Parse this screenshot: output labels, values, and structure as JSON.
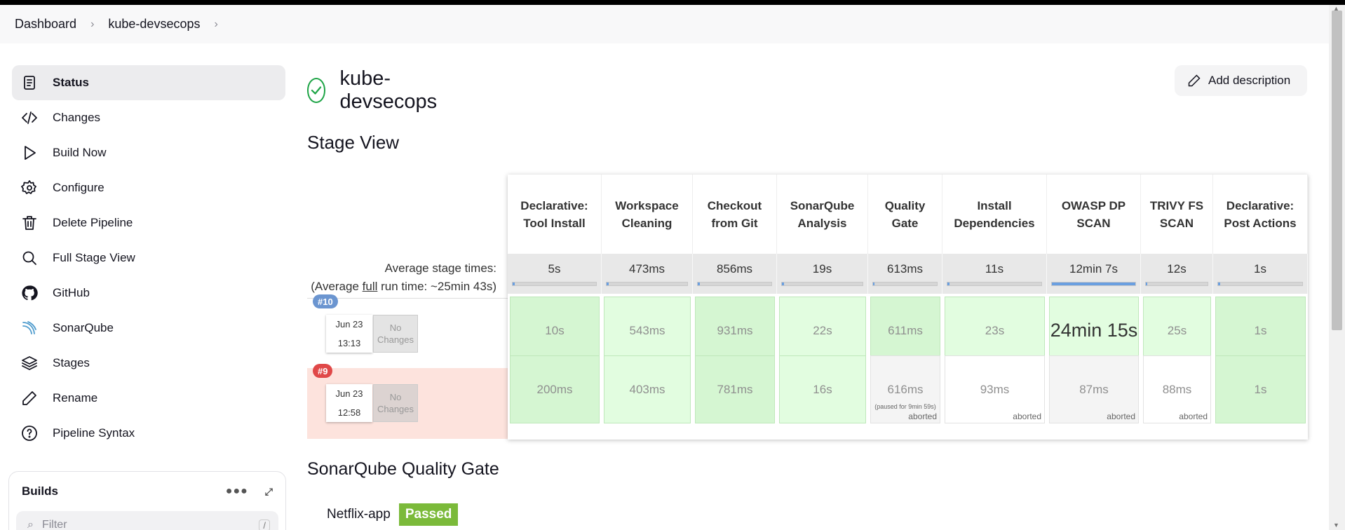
{
  "breadcrumb": {
    "items": [
      "Dashboard",
      "kube-devsecops"
    ]
  },
  "sidebar": {
    "items": [
      {
        "label": "Status",
        "icon": "status-icon"
      },
      {
        "label": "Changes",
        "icon": "code-icon"
      },
      {
        "label": "Build Now",
        "icon": "play-icon"
      },
      {
        "label": "Configure",
        "icon": "gear-icon"
      },
      {
        "label": "Delete Pipeline",
        "icon": "trash-icon"
      },
      {
        "label": "Full Stage View",
        "icon": "search-icon"
      },
      {
        "label": "GitHub",
        "icon": "github-icon"
      },
      {
        "label": "SonarQube",
        "icon": "sonarqube-icon"
      },
      {
        "label": "Stages",
        "icon": "layers-icon"
      },
      {
        "label": "Rename",
        "icon": "pencil-icon"
      },
      {
        "label": "Pipeline Syntax",
        "icon": "help-icon"
      }
    ]
  },
  "builds": {
    "title": "Builds",
    "filter_placeholder": "Filter",
    "filter_shortcut": "/"
  },
  "header": {
    "title": "kube-devsecops",
    "add_description": "Add description"
  },
  "stage_view": {
    "title": "Stage View",
    "avg_label": "Average stage times:",
    "avg_run_prefix": "(Average ",
    "avg_run_link": "full",
    "avg_run_suffix": " run time: ~25min 43s)",
    "stages": [
      {
        "name": "Declarative: Tool Install",
        "avg": "5s",
        "avg_fraction": 0.0
      },
      {
        "name": "Workspace Cleaning",
        "avg": "473ms",
        "avg_fraction": 0.0
      },
      {
        "name": "Checkout from Git",
        "avg": "856ms",
        "avg_fraction": 0.0
      },
      {
        "name": "SonarQube Analysis",
        "avg": "19s",
        "avg_fraction": 0.03
      },
      {
        "name": "Quality Gate",
        "avg": "613ms",
        "avg_fraction": 0.0
      },
      {
        "name": "Install Dependencies",
        "avg": "11s",
        "avg_fraction": 0.02
      },
      {
        "name": "OWASP DP SCAN",
        "avg": "12min 7s",
        "avg_fraction": 1.0
      },
      {
        "name": "TRIVY FS SCAN",
        "avg": "12s",
        "avg_fraction": 0.02
      },
      {
        "name": "Declarative: Post Actions",
        "avg": "1s",
        "avg_fraction": 0.0
      }
    ],
    "builds": [
      {
        "number": "#10",
        "date": "Jun 23",
        "time": "13:13",
        "changes": "No Changes",
        "cells": [
          {
            "value": "10s"
          },
          {
            "value": "543ms"
          },
          {
            "value": "931ms"
          },
          {
            "value": "22s"
          },
          {
            "value": "611ms"
          },
          {
            "value": "23s"
          },
          {
            "value": "24min 15s"
          },
          {
            "value": "25s"
          },
          {
            "value": "1s"
          }
        ]
      },
      {
        "number": "#9",
        "date": "Jun 23",
        "time": "12:58",
        "changes": "No Changes",
        "cells": [
          {
            "value": "200ms"
          },
          {
            "value": "403ms"
          },
          {
            "value": "781ms"
          },
          {
            "value": "16s"
          },
          {
            "value": "616ms",
            "note": "(paused for 9min 59s)",
            "status": "aborted"
          },
          {
            "value": "93ms",
            "status": "aborted"
          },
          {
            "value": "87ms",
            "status": "aborted"
          },
          {
            "value": "88ms",
            "status": "aborted"
          },
          {
            "value": "1s"
          }
        ]
      }
    ]
  },
  "sonarqube_gate": {
    "title": "SonarQube Quality Gate",
    "project": "Netflix-app",
    "status": "Passed"
  },
  "colors": {
    "success": "#1ea446",
    "passed": "#7bba3a",
    "failed_row": "#fde3dd",
    "ok_cell": "#e2fde0"
  }
}
